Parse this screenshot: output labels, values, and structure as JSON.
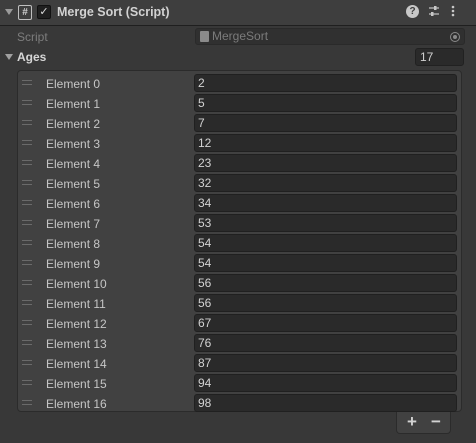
{
  "header": {
    "title": "Merge Sort (Script)",
    "script_icon_glyph": "#",
    "enabled_glyph": "✓",
    "icons": [
      "help-icon",
      "preset-icon",
      "more-icon"
    ]
  },
  "script_field": {
    "label": "Script",
    "value": "MergeSort"
  },
  "ages": {
    "label": "Ages",
    "size": "17",
    "elements": [
      {
        "label": "Element 0",
        "value": "2"
      },
      {
        "label": "Element 1",
        "value": "5"
      },
      {
        "label": "Element 2",
        "value": "7"
      },
      {
        "label": "Element 3",
        "value": "12"
      },
      {
        "label": "Element 4",
        "value": "23"
      },
      {
        "label": "Element 5",
        "value": "32"
      },
      {
        "label": "Element 6",
        "value": "34"
      },
      {
        "label": "Element 7",
        "value": "53"
      },
      {
        "label": "Element 8",
        "value": "54"
      },
      {
        "label": "Element 9",
        "value": "54"
      },
      {
        "label": "Element 10",
        "value": "56"
      },
      {
        "label": "Element 11",
        "value": "56"
      },
      {
        "label": "Element 12",
        "value": "67"
      },
      {
        "label": "Element 13",
        "value": "76"
      },
      {
        "label": "Element 14",
        "value": "87"
      },
      {
        "label": "Element 15",
        "value": "94"
      },
      {
        "label": "Element 16",
        "value": "98"
      }
    ],
    "add_label": "+",
    "remove_label": "−"
  }
}
